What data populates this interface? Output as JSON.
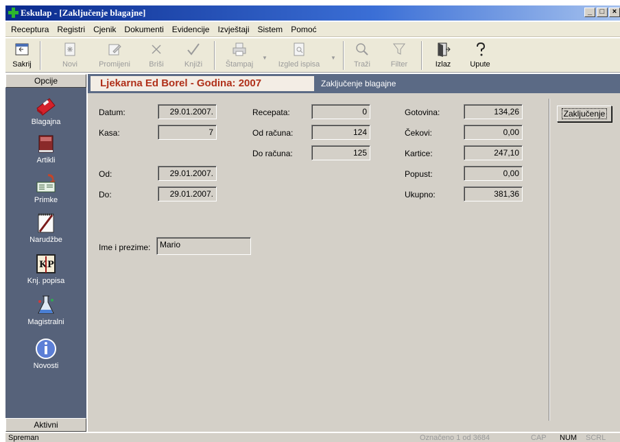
{
  "window": {
    "title": "Eskulap - [Zaključenje blagajne]",
    "buttons": [
      "_",
      "□",
      "×"
    ]
  },
  "menu": [
    "Receptura",
    "Registri",
    "Cjenik",
    "Dokumenti",
    "Evidencije",
    "Izvještaji",
    "Sistem",
    "Pomoć"
  ],
  "toolbar": {
    "sakrij": "Sakrij",
    "novi": "Novi",
    "promijeni": "Promijeni",
    "brisi": "Briši",
    "knjizi": "Knjiži",
    "stampaj": "Štampaj",
    "izgled": "Izgled ispisa",
    "trazi": "Traži",
    "filter": "Filter",
    "izlaz": "Izlaz",
    "upute": "Upute"
  },
  "sidebar": {
    "header": "Opcije",
    "footer": "Aktivni",
    "items": [
      {
        "label": "Blagajna",
        "icon": "cash-register-icon"
      },
      {
        "label": "Artikli",
        "icon": "book-icon"
      },
      {
        "label": "Primke",
        "icon": "receipt-icon"
      },
      {
        "label": "Narudžbe",
        "icon": "notepad-icon"
      },
      {
        "label": "Knj. popisa",
        "icon": "kp-book-icon"
      },
      {
        "label": "Magistralni",
        "icon": "flask-icon"
      },
      {
        "label": "Novosti",
        "icon": "info-icon"
      }
    ]
  },
  "header": {
    "pharmacy": "Ljekarna Ed Borel - Godina: 2007",
    "screen_title": "Zaključenje blagajne"
  },
  "form": {
    "datum_label": "Datum:",
    "datum": "29.01.2007.",
    "kasa_label": "Kasa:",
    "kasa": "7",
    "od_label": "Od:",
    "od": "29.01.2007.",
    "do_label": "Do:",
    "do": "29.01.2007.",
    "recepata_label": "Recepata:",
    "recepata": "0",
    "od_racuna_label": "Od računa:",
    "od_racuna": "124",
    "do_racuna_label": "Do računa:",
    "do_racuna": "125",
    "gotovina_label": "Gotovina:",
    "gotovina": "134,26",
    "cekovi_label": "Čekovi:",
    "cekovi": "0,00",
    "kartice_label": "Kartice:",
    "kartice": "247,10",
    "popust_label": "Popust:",
    "popust": "0,00",
    "ukupno_label": "Ukupno:",
    "ukupno": "381,36",
    "ime_label": "Ime i prezime:",
    "ime": "Mario",
    "zakljucenje_button": "Zaključenje"
  },
  "status": {
    "left": "Spreman",
    "selection": "Označeno 1 od 3684",
    "cap": "CAP",
    "num": "NUM",
    "scrl": "SCRL"
  },
  "colors": {
    "title_accent": "#b0301a",
    "sidebar_bg": "#56627a",
    "panel_bg": "#d4d0c8"
  }
}
